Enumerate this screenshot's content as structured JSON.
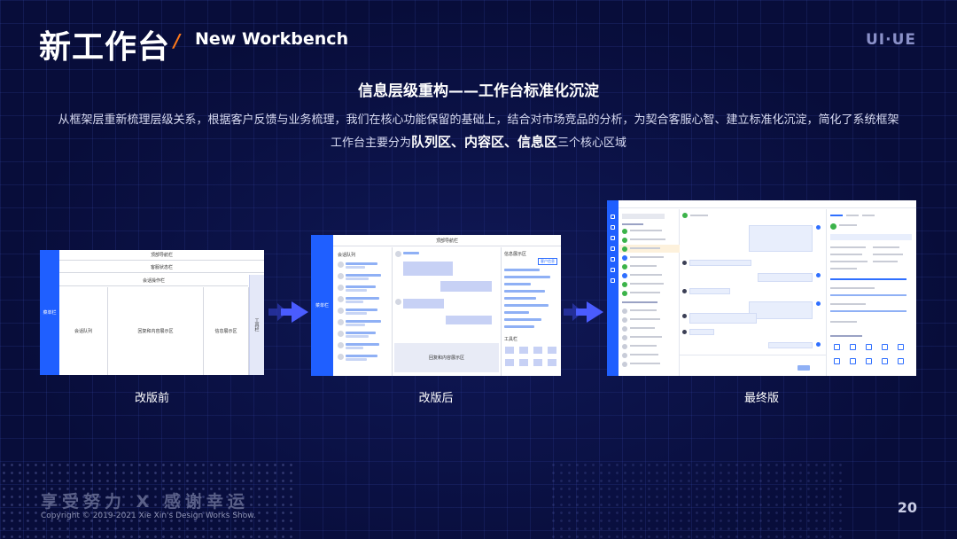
{
  "header": {
    "title_cn": "新工作台",
    "slash": "/",
    "title_en": "New Workbench",
    "brand": "UI·UE"
  },
  "section": {
    "title": "信息层级重构——工作台标准化沉淀",
    "desc_line1": "从框架层重新梳理层级关系，根据客户反馈与业务梳理，我们在核心功能保留的基础上，结合对市场竞品的分析，为契合客服心智、建立标准化沉淀，简化了系统框架",
    "desc_line2_prefix": "工作台主要分为",
    "desc_line2_bold": "队列区、内容区、信息区",
    "desc_line2_suffix": "三个核心区域"
  },
  "panels": {
    "before": {
      "caption": "改版前",
      "nav": "菜单栏",
      "top_nav": "顶部导航栏",
      "status_bar": "客服状态栏",
      "notice_bar": "会话操作栏",
      "queue": "会话队列",
      "content": "回复和内容展示区",
      "info": "信息展示区",
      "tools": "工具栏"
    },
    "after": {
      "caption": "改版后",
      "nav": "菜单栏",
      "top_nav": "顶部导航栏",
      "queue": "会话队列",
      "info": "信息展示区",
      "info_tag": "客户信息",
      "content": "回复和内容展示区",
      "tools": "工具栏"
    },
    "final": {
      "caption": "最终版"
    }
  },
  "footer": {
    "slogan": "享受努力 X 感谢幸运",
    "copyright": "Copyright © 2019-2021 Xie Xin's Design Works Show.",
    "page": "20"
  },
  "colors": {
    "background": "#080d3a",
    "accent": "#ff7a1a",
    "nav_blue": "#1f5fff",
    "arrow": "#4a5cff"
  }
}
